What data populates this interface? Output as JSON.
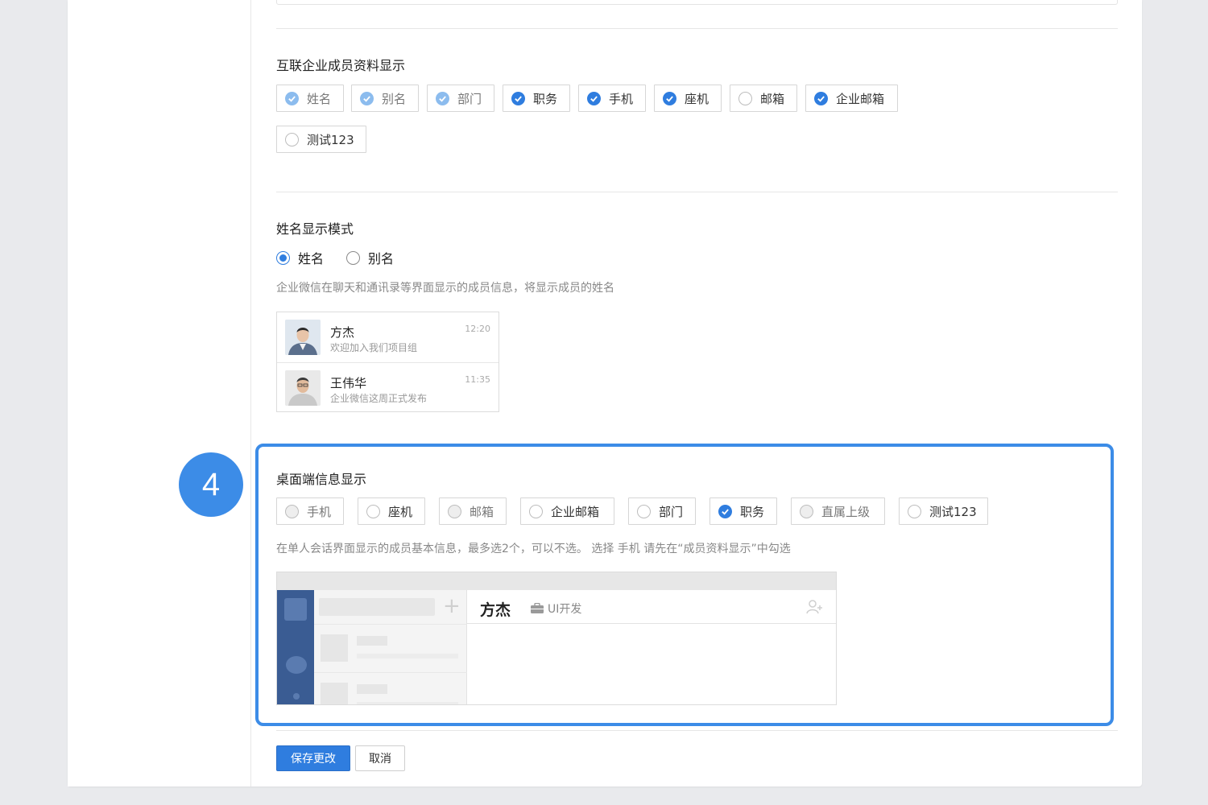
{
  "profile_section": {
    "title": "互联企业成员资料显示",
    "options": [
      {
        "label": "姓名",
        "state": "disabled-checked"
      },
      {
        "label": "别名",
        "state": "disabled-checked"
      },
      {
        "label": "部门",
        "state": "disabled-checked"
      },
      {
        "label": "职务",
        "state": "checked"
      },
      {
        "label": "手机",
        "state": "checked"
      },
      {
        "label": "座机",
        "state": "checked"
      },
      {
        "label": "邮箱",
        "state": "unchecked"
      },
      {
        "label": "企业邮箱",
        "state": "checked"
      },
      {
        "label": "测试123",
        "state": "unchecked"
      }
    ]
  },
  "name_mode": {
    "title": "姓名显示模式",
    "options": [
      {
        "label": "姓名",
        "selected": true
      },
      {
        "label": "别名",
        "selected": false
      }
    ],
    "hint": "企业微信在聊天和通讯录等界面显示的成员信息，将显示成员的姓名",
    "chats": [
      {
        "name": "方杰",
        "message": "欢迎加入我们项目组",
        "time": "12:20"
      },
      {
        "name": "王伟华",
        "message": "企业微信这周正式发布",
        "time": "11:35"
      }
    ]
  },
  "step_badge": "4",
  "desktop_section": {
    "title": "桌面端信息显示",
    "options": [
      {
        "label": "手机",
        "state": "disabled"
      },
      {
        "label": "座机",
        "state": "unchecked"
      },
      {
        "label": "邮箱",
        "state": "disabled"
      },
      {
        "label": "企业邮箱",
        "state": "unchecked"
      },
      {
        "label": "部门",
        "state": "unchecked"
      },
      {
        "label": "职务",
        "state": "checked"
      },
      {
        "label": "直属上级",
        "state": "disabled"
      },
      {
        "label": "测试123",
        "state": "unchecked"
      }
    ],
    "hint": "在单人会话界面显示的成员基本信息，最多选2个，可以不选。 选择 手机 请先在“成员资料显示”中勾选",
    "preview": {
      "name": "方杰",
      "job": "UI开发"
    }
  },
  "actions": {
    "save": "保存更改",
    "cancel": "取消"
  },
  "colors": {
    "accent": "#2f7ddf",
    "highlight": "#3c8ce7"
  }
}
